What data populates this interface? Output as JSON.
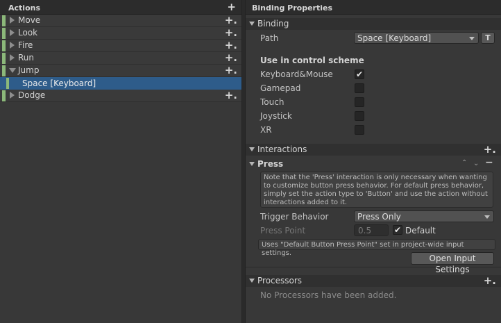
{
  "actions_panel": {
    "title": "Actions",
    "items": [
      {
        "name": "Move"
      },
      {
        "name": "Look"
      },
      {
        "name": "Fire"
      },
      {
        "name": "Run"
      },
      {
        "name": "Jump"
      },
      {
        "binding": "Space [Keyboard]"
      },
      {
        "name": "Dodge"
      }
    ]
  },
  "properties_panel": {
    "title": "Binding Properties",
    "binding_section": {
      "header": "Binding",
      "path_label": "Path",
      "path_value": "Space [Keyboard]",
      "t_button": "T",
      "scheme_heading": "Use in control scheme",
      "schemes": [
        {
          "label": "Keyboard&Mouse",
          "checked": true
        },
        {
          "label": "Gamepad",
          "checked": false
        },
        {
          "label": "Touch",
          "checked": false
        },
        {
          "label": "Joystick",
          "checked": false
        },
        {
          "label": "XR",
          "checked": false
        }
      ]
    },
    "interactions_section": {
      "header": "Interactions",
      "press": {
        "header": "Press",
        "note": "Note that the 'Press' interaction is only necessary when wanting to customize button press behavior. For default press behavior, simply set the action type to 'Button' and use the action without interactions added to it.",
        "trigger_label": "Trigger Behavior",
        "trigger_value": "Press Only",
        "press_point_label": "Press Point",
        "press_point_value": "0.5",
        "default_label": "Default",
        "default_checked": true,
        "default_note": "Uses \"Default Button Press Point\" set in project-wide input settings.",
        "open_settings_button": "Open Input Settings"
      }
    },
    "processors_section": {
      "header": "Processors",
      "empty_text": "No Processors have been added."
    }
  },
  "colors": {
    "action_bar": "#8cb87a",
    "selection": "#2e5c8a"
  }
}
